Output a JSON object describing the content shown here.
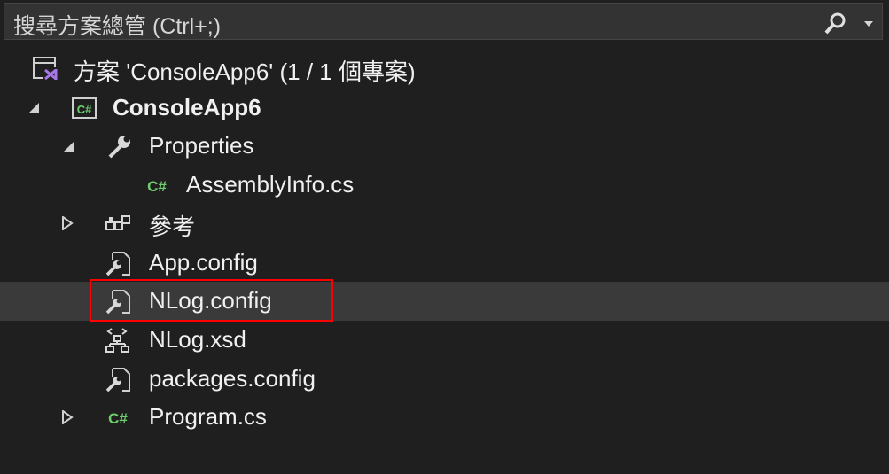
{
  "search": {
    "placeholder": "搜尋方案總管 (Ctrl+;)"
  },
  "tree": {
    "solution": "方案 'ConsoleApp6' (1 / 1 個專案)",
    "project": "ConsoleApp6",
    "properties": "Properties",
    "assemblyinfo": "AssemblyInfo.cs",
    "references": "參考",
    "app_config": "App.config",
    "nlog_config": "NLog.config",
    "nlog_xsd": "NLog.xsd",
    "packages_config": "packages.config",
    "program": "Program.cs"
  },
  "colors": {
    "csharp": "#6fcf6f",
    "vs_purple": "#a777e8",
    "highlight": "#ff0000"
  }
}
